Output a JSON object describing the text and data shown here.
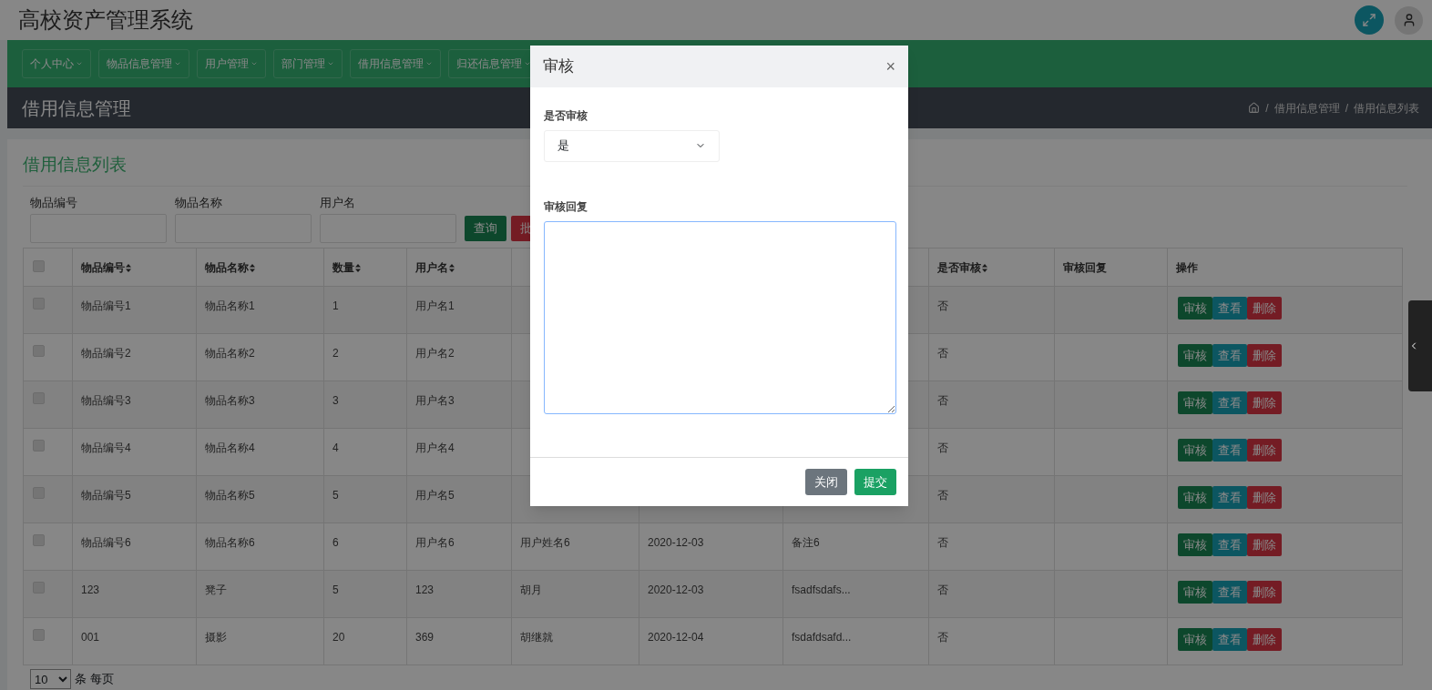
{
  "header": {
    "title": "高校资产管理系统"
  },
  "nav": {
    "items": [
      {
        "label": "个人中心"
      },
      {
        "label": "物品信息管理"
      },
      {
        "label": "用户管理"
      },
      {
        "label": "部门管理"
      },
      {
        "label": "借用信息管理"
      },
      {
        "label": "归还信息管理"
      }
    ]
  },
  "page_title": "借用信息管理",
  "breadcrumb": [
    {
      "separator": "/",
      "label": "借用信息管理"
    },
    {
      "separator": "/",
      "label": "借用信息列表"
    }
  ],
  "card_title": "借用信息列表",
  "search": {
    "fields": [
      {
        "label": "物品编号"
      },
      {
        "label": "物品名称"
      },
      {
        "label": "用户名"
      }
    ],
    "buttons": [
      {
        "label": "查询",
        "kind": "primary"
      },
      {
        "label": "批",
        "kind": "danger"
      }
    ]
  },
  "table": {
    "select_all_checked": false,
    "columns_left": [
      {
        "label": "物品编号",
        "sortable": true
      },
      {
        "label": "物品名称",
        "sortable": true
      },
      {
        "label": "数量",
        "sortable": true
      },
      {
        "label": "用户名",
        "sortable": true
      }
    ],
    "columns_right": [
      {
        "label": "是否审核",
        "sortable": true
      },
      {
        "label": "审核回复",
        "sortable": false
      },
      {
        "label": "操作",
        "sortable": false
      }
    ],
    "rows": [
      {
        "checked": false,
        "cells": [
          "物品编号1",
          "物品名称1",
          "1",
          "用户名1",
          null,
          null,
          null,
          "否",
          null
        ],
        "actions": [
          "审核",
          "查看",
          "删除"
        ]
      },
      {
        "checked": false,
        "cells": [
          "物品编号2",
          "物品名称2",
          "2",
          "用户名2",
          null,
          null,
          null,
          "否",
          null
        ],
        "actions": [
          "审核",
          "查看",
          "删除"
        ]
      },
      {
        "checked": false,
        "cells": [
          "物品编号3",
          "物品名称3",
          "3",
          "用户名3",
          null,
          null,
          null,
          "否",
          null
        ],
        "actions": [
          "审核",
          "查看",
          "删除"
        ]
      },
      {
        "checked": false,
        "cells": [
          "物品编号4",
          "物品名称4",
          "4",
          "用户名4",
          null,
          null,
          null,
          "否",
          null
        ],
        "actions": [
          "审核",
          "查看",
          "删除"
        ]
      },
      {
        "checked": false,
        "cells": [
          "物品编号5",
          "物品名称5",
          "5",
          "用户名5",
          null,
          null,
          null,
          "否",
          null
        ],
        "actions": [
          "审核",
          "查看",
          "删除"
        ]
      },
      {
        "checked": false,
        "cells": [
          "物品编号6",
          "物品名称6",
          "6",
          "用户名6",
          "用户姓名6",
          "2020-12-03",
          "备注6",
          "否",
          null
        ],
        "actions": [
          "审核",
          "查看",
          "删除"
        ]
      },
      {
        "checked": false,
        "cells": [
          "123",
          "凳子",
          "5",
          "123",
          "胡月",
          "2020-12-03",
          "fsadfsdafs...",
          "否",
          null
        ],
        "actions": [
          "审核",
          "查看",
          "删除"
        ]
      },
      {
        "checked": false,
        "cells": [
          "001",
          "摄影",
          "20",
          "369",
          "胡继就",
          "2020-12-04",
          "fsdafdsafd...",
          "否",
          null
        ],
        "actions": [
          "审核",
          "查看",
          "删除"
        ]
      }
    ]
  },
  "pagination": {
    "page_size": "10",
    "label": "条 每页"
  },
  "modal": {
    "title": "审核",
    "close": "×",
    "fields": [
      {
        "kind": "select",
        "label": "是否审核",
        "value": "是"
      },
      {
        "kind": "textarea",
        "label": "审核回复"
      }
    ],
    "buttons": [
      {
        "label": "关闭",
        "kind": "secondary"
      },
      {
        "label": "提交",
        "kind": "success"
      }
    ]
  }
}
